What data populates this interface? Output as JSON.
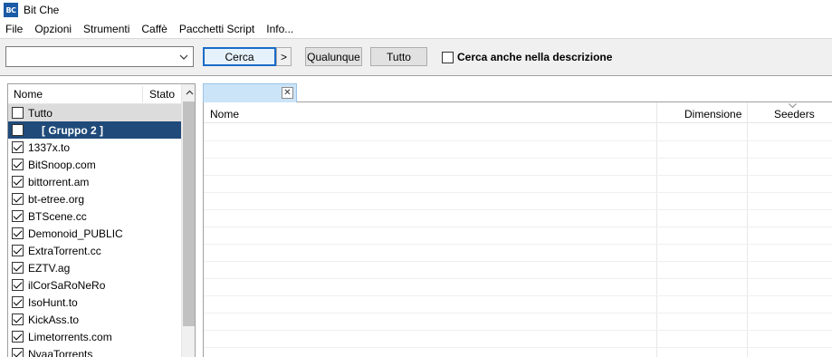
{
  "window": {
    "title": "Bit Che",
    "icon_text": "BC"
  },
  "menu": [
    "File",
    "Opzioni",
    "Strumenti",
    "Caffè",
    "Pacchetti Script",
    "Info..."
  ],
  "toolbar": {
    "search_value": "",
    "search_button": "Cerca",
    "next_glyph": ">",
    "any_button": "Qualunque",
    "all_button": "Tutto",
    "desc_checkbox_label": "Cerca anche nella descrizione",
    "desc_checked": false
  },
  "sites_panel": {
    "col_name": "Nome",
    "col_status": "Stato",
    "rows": [
      {
        "label": "Tutto",
        "checked": false,
        "style": "gray"
      },
      {
        "label": "[ Gruppo 2 ]",
        "checked": false,
        "style": "blue"
      },
      {
        "label": "1337x.to",
        "checked": true
      },
      {
        "label": "BitSnoop.com",
        "checked": true
      },
      {
        "label": "bittorrent.am",
        "checked": true
      },
      {
        "label": "bt-etree.org",
        "checked": true
      },
      {
        "label": "BTScene.cc",
        "checked": true
      },
      {
        "label": "Demonoid_PUBLIC",
        "checked": true
      },
      {
        "label": "ExtraTorrent.cc",
        "checked": true
      },
      {
        "label": "EZTV.ag",
        "checked": true
      },
      {
        "label": "ilCorSaRoNeRo",
        "checked": true
      },
      {
        "label": "IsoHunt.to",
        "checked": true
      },
      {
        "label": "KickAss.to",
        "checked": true
      },
      {
        "label": "Limetorrents.com",
        "checked": true
      },
      {
        "label": "NyaaTorrents",
        "checked": true
      }
    ]
  },
  "results": {
    "tab_label": "",
    "col_name": "Nome",
    "col_size": "Dimensione",
    "col_seeders": "Seeders",
    "rows": []
  }
}
